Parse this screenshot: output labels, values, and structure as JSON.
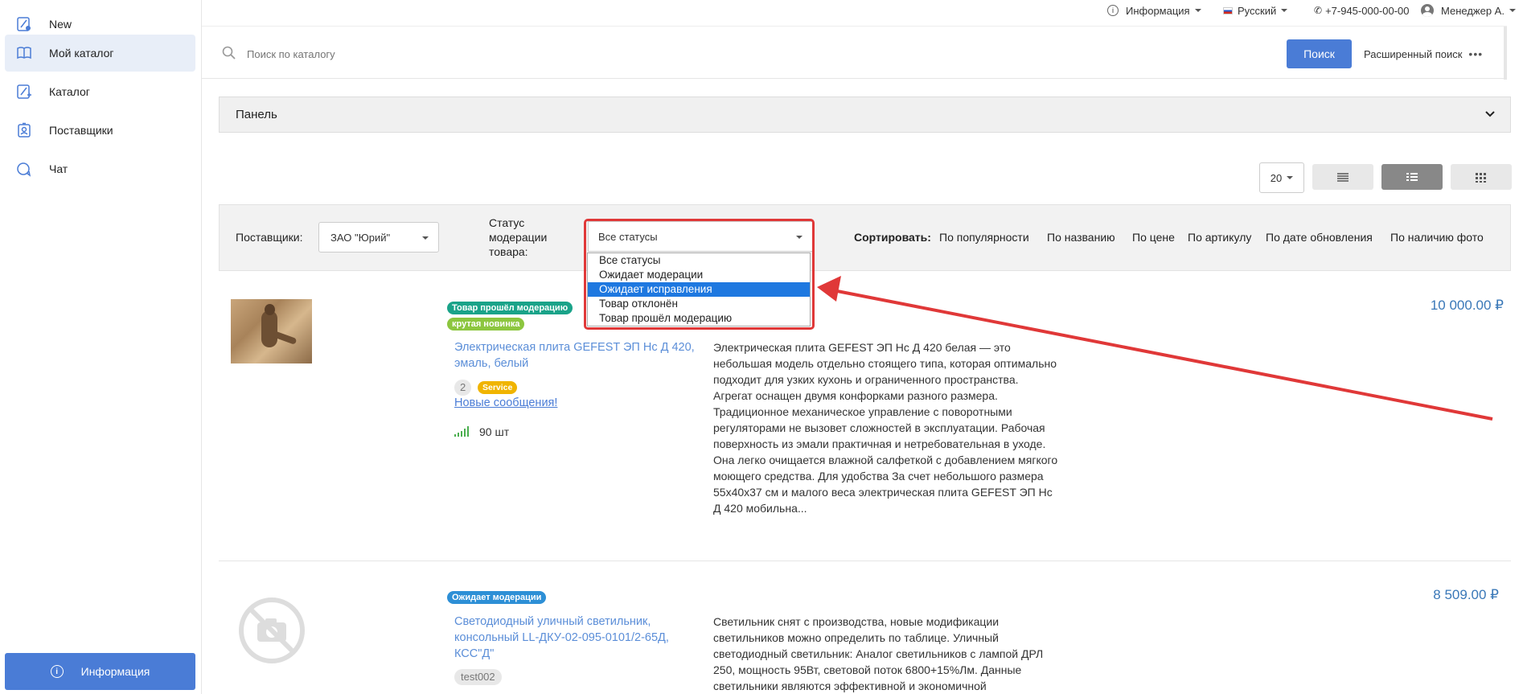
{
  "sidebar": {
    "items": [
      {
        "label": "New",
        "icon": "new-catalog-icon"
      },
      {
        "label": "Мой каталог",
        "icon": "book-icon"
      },
      {
        "label": "Каталог",
        "icon": "catalog-icon"
      },
      {
        "label": "Поставщики",
        "icon": "supplier-badge-icon"
      },
      {
        "label": "Чат",
        "icon": "chat-icon"
      }
    ],
    "info_button": "Информация"
  },
  "topbar": {
    "info": "Информация",
    "language": "Русский",
    "phone": "+7-945-000-00-00",
    "user": "Менеджер А."
  },
  "search": {
    "placeholder": "Поиск по каталогу",
    "button": "Поиск",
    "advanced": "Расширенный поиск"
  },
  "panel": {
    "title": "Панель"
  },
  "view": {
    "per_page": "20"
  },
  "filters": {
    "suppliers_label": "Поставщики:",
    "supplier_value": "ЗАО \"Юрий\"",
    "status_label_lines": [
      "Статус",
      "модерации",
      "товара:"
    ],
    "status_value": "Все статусы",
    "status_options": [
      "Все статусы",
      "Ожидает модерации",
      "Ожидает исправления",
      "Товар отклонён",
      "Товар прошёл модерацию"
    ],
    "status_selected_index": 2,
    "sort_label": "Сортировать:",
    "sort_options": [
      "По популярности",
      "По названию",
      "По цене",
      "По артикулу",
      "По дате обновления",
      "По наличию фото"
    ]
  },
  "products": [
    {
      "badges": [
        "Товар прошёл модерацию",
        "крутая новинка"
      ],
      "title": "Электрическая плита GEFEST ЭП Нс Д 420, эмаль, белый",
      "tag_count": "2",
      "tag_service": "Service",
      "messages_link": "Новые сообщения!",
      "stock": "90 шт",
      "description": "Электрическая плита GEFEST ЭП Нс Д 420 белая — это небольшая модель отдельно стоящего типа, которая оптимально подходит для узких кухонь и ограниченного пространства. Агрегат оснащен двумя конфорками разного размера. Традиционное механическое управление с поворотными регуляторами не вызовет сложностей в эксплуатации. Рабочая поверхность из эмали практичная и нетребовательная в уходе. Она легко очищается влажной салфеткой с добавлением мягкого моющего средства. Для удобства За счет небольшого размера 55x40x37 см и малого веса электрическая плита GEFEST ЭП Нс Д 420 мобильна...",
      "price": "10 000.00 ₽"
    },
    {
      "badges": [
        "Ожидает модерации"
      ],
      "title": "Светодиодный уличный светильник, консольный LL-ДКУ-02-095-0101/2-65Д, КСС\"Д\"",
      "tag": "test002",
      "description": "Светильник снят с производства, новые модификации светильников можно определить по таблице. Уличный светодиодный светильник: Аналог светильников с лампой ДРЛ 250, мощность 95Вт, световой поток 6800+15%Лм. Данные светильники являются эффективной и экономичной",
      "price": "8 509.00 ₽"
    }
  ],
  "colors": {
    "accent": "#4a7cd6",
    "badge_passed": "#1aa389",
    "badge_new": "#8cc63f",
    "badge_waiting": "#2d8fd6",
    "badge_service": "#f0b400",
    "annotation_red": "#e03838"
  }
}
